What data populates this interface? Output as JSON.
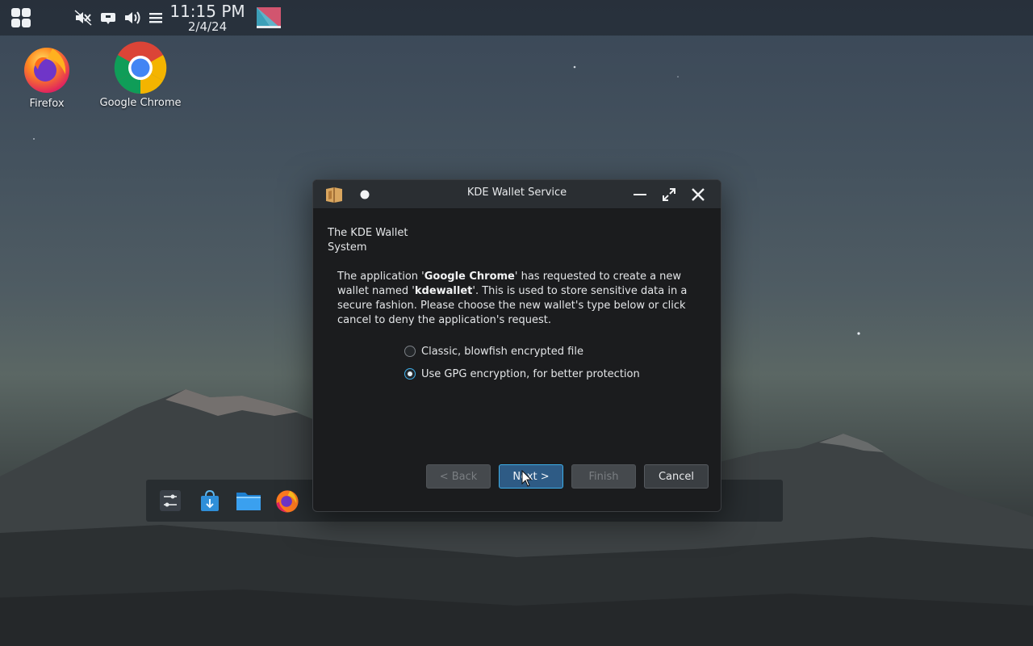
{
  "top_panel": {
    "clock_time": "11:15 PM",
    "clock_date": "2/4/24",
    "icons": [
      "app-launcher-icon",
      "muted-speaker-icon",
      "tray-icon",
      "volume-icon",
      "menu-icon",
      "desktop-switcher-icon"
    ]
  },
  "desktop": {
    "icons": [
      {
        "label": "Firefox",
        "icon": "firefox-icon"
      },
      {
        "label": "Google Chrome",
        "icon": "chrome-icon"
      }
    ]
  },
  "dock": {
    "items": [
      "settings-icon",
      "discover-store-icon",
      "file-manager-icon",
      "firefox-icon",
      "kwallet-icon"
    ]
  },
  "dialog": {
    "title": "KDE Wallet Service",
    "header_line1": "The KDE Wallet",
    "header_line2": "System",
    "desc_part1": "The application '",
    "desc_app": "Google Chrome",
    "desc_part2": "' has requested to create a new wallet named '",
    "desc_wallet": "kdewallet",
    "desc_part3": "'. This is used to store sensitive data in a secure fashion. Please choose the new wallet's type below or click cancel to deny the application's request.",
    "options": [
      {
        "label": "Classic, blowfish encrypted file",
        "checked": false
      },
      {
        "label": "Use GPG encryption, for better protection",
        "checked": true
      }
    ],
    "buttons": {
      "back": "< Back",
      "next": "Next >",
      "finish": "Finish",
      "cancel": "Cancel"
    }
  },
  "colors": {
    "accent": "#3daee9",
    "dialog_bg": "#1b1c1e",
    "titlebar_bg": "#2a2e32"
  }
}
